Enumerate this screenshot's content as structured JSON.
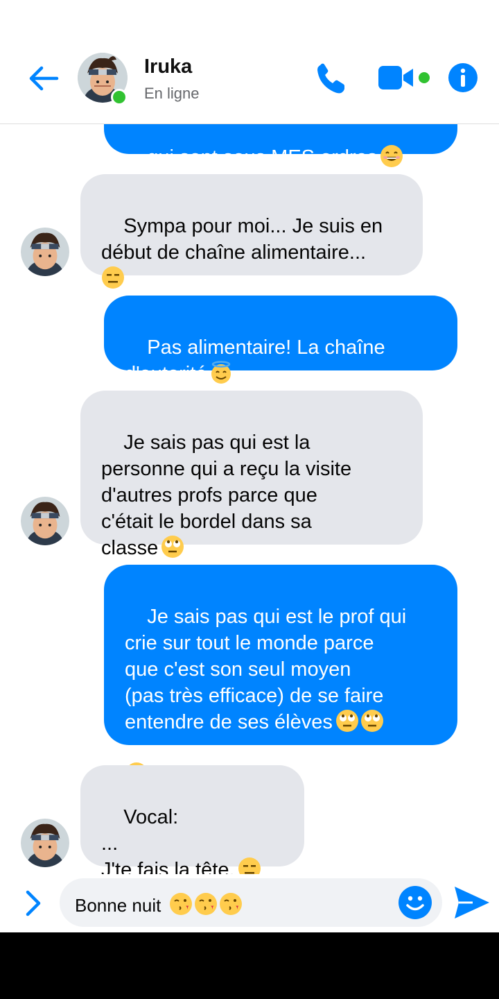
{
  "header": {
    "contact_name": "Iruka",
    "status": "En ligne",
    "accent_color": "#0084ff",
    "online_color": "#31c231",
    "icons": [
      "back-arrow-icon",
      "phone-icon",
      "video-camera-icon",
      "info-icon"
    ]
  },
  "messages": [
    {
      "side": "sent",
      "text": "qui sont sous MES ordres",
      "emoji": [
        "grinning-face"
      ]
    },
    {
      "side": "received",
      "text": "Sympa pour moi... Je suis en\ndébut de chaîne alimentaire...\n",
      "emoji": [
        "expressionless-face"
      ]
    },
    {
      "side": "sent",
      "text": "Pas alimentaire! La chaîne\nd'autorité",
      "emoji": [
        "smiling-face-with-halo"
      ]
    },
    {
      "side": "received",
      "text": "Je sais pas qui est la\npersonne qui a reçu la visite\nd'autres profs parce que\nc'était le bordel dans sa\nclasse",
      "emoji": [
        "face-with-rolling-eyes"
      ]
    },
    {
      "side": "sent",
      "text": "Je sais pas qui est le prof qui\ncrie sur tout le monde parce\nque c'est son seul moyen\n(pas très efficace) de se faire\nentendre de ses élèves",
      "emoji": [
        "face-with-rolling-eyes",
        "face-with-rolling-eyes",
        "face-with-rolling-eyes"
      ]
    },
    {
      "side": "received",
      "text": "Vocal:\n...\nJ'te fais la tête.",
      "emoji": [
        "expressionless-face"
      ]
    }
  ],
  "composer": {
    "value": "Bonne nuit",
    "emoji": [
      "face-blowing-kiss",
      "face-blowing-kiss",
      "face-blowing-kiss"
    ],
    "icons": [
      "chevron-right-icon",
      "smiley-icon",
      "send-icon"
    ]
  }
}
